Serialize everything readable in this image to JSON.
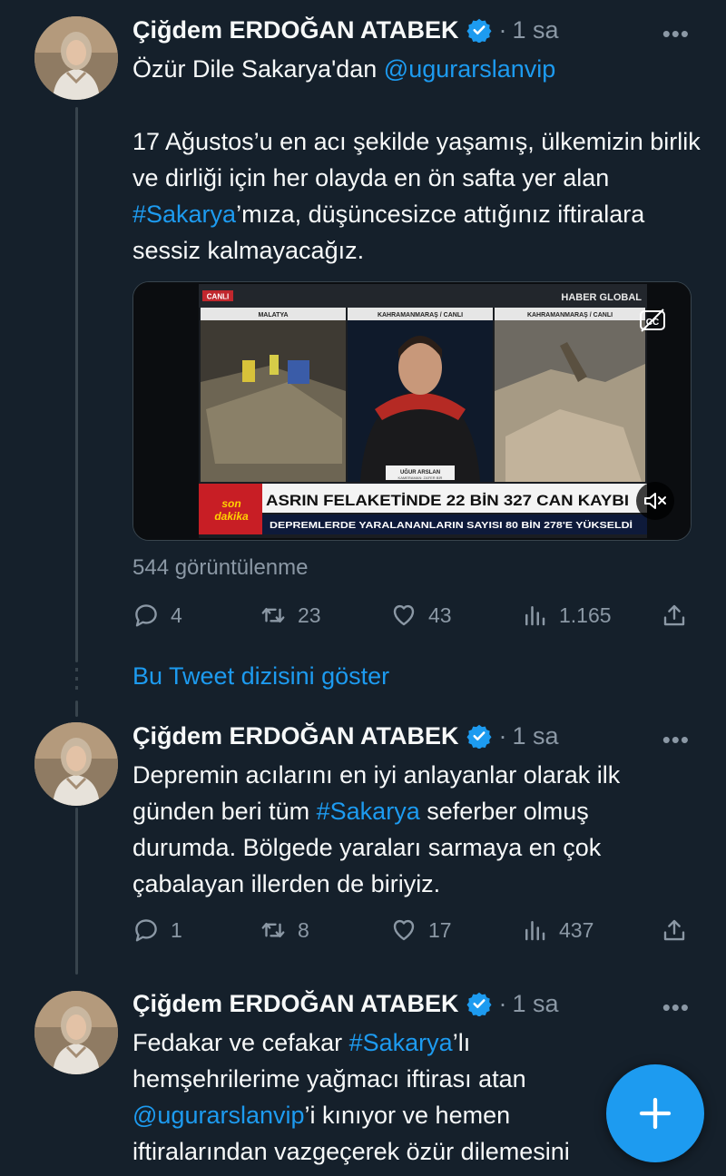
{
  "colors": {
    "background": "#15202b",
    "accent": "#1d9bf0",
    "secondary_text": "#8b98a5"
  },
  "tweets": [
    {
      "author": "Çiğdem ERDOĞAN ATABEK",
      "separator": "·",
      "time": "1 sa",
      "text_line1_pre": "Özür Dile Sakarya'dan ",
      "text_line1_mention": "@ugurarslanvip",
      "text_para2_pre": "17 Ağustos’u en acı şekilde yaşamış, ülkemizin birlik ve dirliği için her olayda en ön safta yer alan ",
      "text_para2_hashtag": "#Sakarya",
      "text_para2_post": "’mıza, düşüncesizce attığınız iftiralara sessiz kalmayacağız.",
      "media": {
        "live_badge": "CANLI",
        "channel": "HABER GLOBAL",
        "panel_labels": [
          "MALATYA",
          "KAHRAMANMARAŞ / CANLI",
          "KAHRAMANMARAŞ / CANLI"
        ],
        "reporter_name": "UĞUR ARSLAN",
        "reporter_sub": "KAMERAMAN: ZAFER BİR",
        "ticker_tag_top": "son",
        "ticker_tag_bottom": "dakika",
        "headline": "ASRIN FELAKETİNDE 22 BİN 327 CAN KAYBI",
        "subline": "DEPREMLERDE YARALANANLARIN SAYISI 80 BİN 278'E YÜKSELDİ"
      },
      "views": "544 görüntülenme",
      "replies": "4",
      "retweets": "23",
      "likes": "43",
      "analytics": "1.165"
    },
    {
      "author": "Çiğdem ERDOĞAN ATABEK",
      "separator": "·",
      "time": "1 sa",
      "text_pre": "Depremin acılarını en iyi anlayanlar olarak ilk günden beri tüm ",
      "text_hashtag": "#Sakarya",
      "text_post": " seferber olmuş durumda. Bölgede yaraları sarmaya en çok çabalayan illerden de biriyiz.",
      "replies": "1",
      "retweets": "8",
      "likes": "17",
      "analytics": "437"
    },
    {
      "author": "Çiğdem ERDOĞAN ATABEK",
      "separator": "·",
      "time": "1 sa",
      "text_pre": "Fedakar ve cefakar ",
      "text_hashtag": "#Sakarya",
      "text_mid": "’lı hemşehrilerime yağmacı iftirası atan ",
      "text_mention": "@ugurarslanvip",
      "text_post": "’i kınıyor ve hemen iftiralarından vazgeçerek özür dilemesini"
    }
  ],
  "show_thread": "Bu Tweet dizisini göster",
  "more_menu": "•••"
}
